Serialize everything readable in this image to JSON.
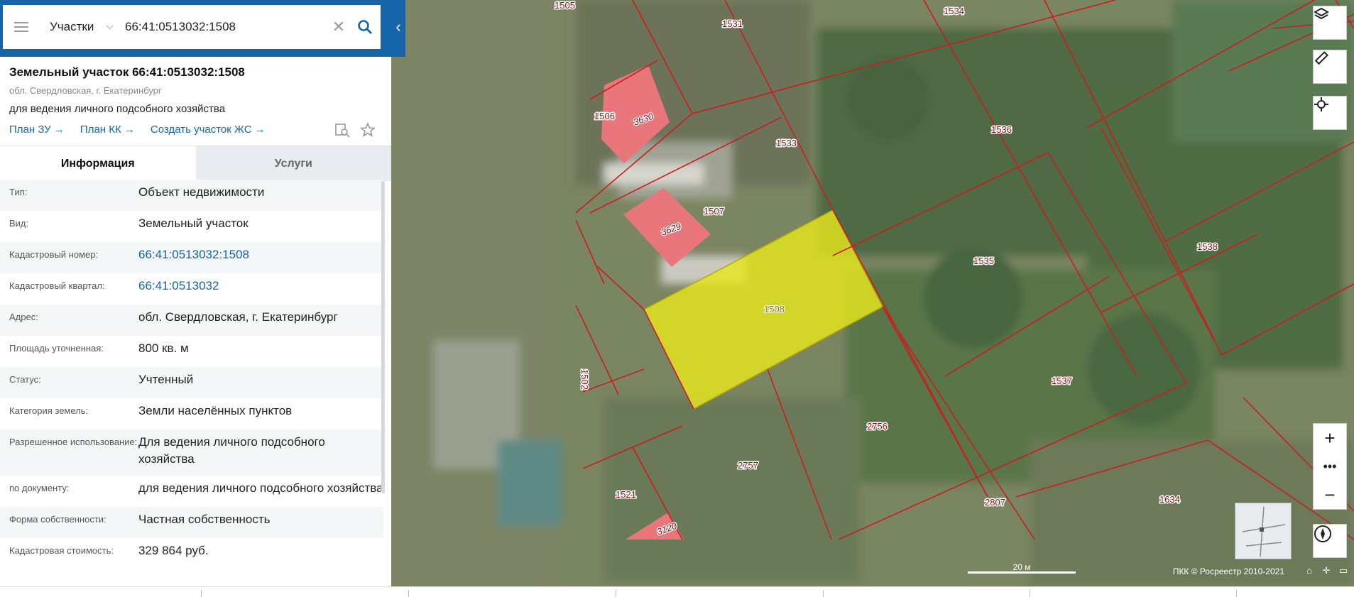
{
  "search": {
    "type_label": "Участки",
    "value": "66:41:0513032:1508"
  },
  "card": {
    "title": "Земельный участок 66:41:0513032:1508",
    "address": "обл. Свердловская, г. Екатеринбург",
    "purpose": "для ведения личного подсобного хозяйства",
    "links": [
      "План ЗУ →",
      "План КК →",
      "Создать участок ЖС →"
    ]
  },
  "tabs": {
    "info": "Информация",
    "services": "Услуги"
  },
  "properties": [
    {
      "label": "Тип:",
      "value": "Объект недвижимости"
    },
    {
      "label": "Вид:",
      "value": "Земельный участок"
    },
    {
      "label": "Кадастровый номер:",
      "value": "66:41:0513032:1508"
    },
    {
      "label": "Кадастровый квартал:",
      "value": "66:41:0513032"
    },
    {
      "label": "Адрес:",
      "value": "обл. Свердловская, г. Екатеринбург"
    },
    {
      "label": "Площадь уточненная:",
      "value": "800 кв. м"
    },
    {
      "label": "Статус:",
      "value": "Учтенный"
    },
    {
      "label": "Категория земель:",
      "value": "Земли населённых пунктов"
    },
    {
      "label": "Разрешенное использование:",
      "value": "Для ведения личного подсобного хозяйства"
    },
    {
      "label": "по документу:",
      "value": "для ведения личного подсобного хозяйства"
    },
    {
      "label": "Форма собственности:",
      "value": "Частная собственность"
    },
    {
      "label": "Кадастровая стоимость:",
      "value": "329 864 руб."
    }
  ],
  "map": {
    "plot_labels": [
      "1505",
      "1531",
      "1534",
      "1506",
      "1533",
      "1536",
      "1507",
      "1535",
      "1538",
      "1502",
      "1537",
      "2756",
      "2757",
      "1521",
      "2807",
      "1634"
    ],
    "building_labels": [
      "3630",
      "3629",
      "3120"
    ],
    "selected_label": "1508",
    "scale_label": "20 м",
    "copyright": "ПКК © Росреестр 2010-2021",
    "colors": {
      "parcel_line": "#c81e1e",
      "building": "#e8767a",
      "selected": "#e6e61e"
    }
  }
}
